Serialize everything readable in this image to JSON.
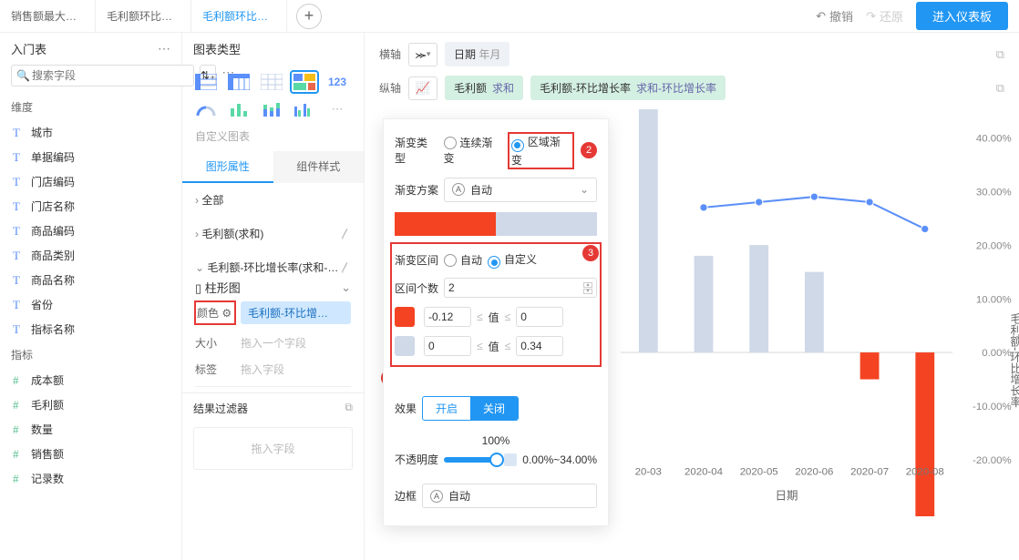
{
  "topbar": {
    "tabs": [
      "销售额最大的…",
      "毛利额环比增…",
      "毛利额环比增…"
    ],
    "active": 2,
    "undo": "撤销",
    "redo": "还原",
    "enter": "进入仪表板"
  },
  "leftA": {
    "title": "入门表",
    "search_ph": "搜索字段",
    "dim_label": "维度",
    "dims": [
      "城市",
      "单据编码",
      "门店编码",
      "门店名称",
      "商品编码",
      "商品类别",
      "商品名称",
      "省份",
      "指标名称"
    ],
    "meas_label": "指标",
    "meas": [
      "成本额",
      "毛利额",
      "数量",
      "销售额",
      "记录数"
    ]
  },
  "leftB": {
    "title": "图表类型",
    "custom": "自定义图表",
    "tab1": "图形属性",
    "tab2": "组件样式",
    "acc_all": "全部",
    "acc_m1": "毛利额(求和)",
    "acc_m2": "毛利额-环比增长率(求和-…",
    "shape": "柱形图",
    "color_lbl": "颜色",
    "color_chip": "毛利额-环比增…",
    "size_lbl": "大小",
    "size_ph": "拖入一个字段",
    "label_lbl": "标签",
    "label_ph": "拖入字段",
    "filter_title": "结果过滤器",
    "filter_ph": "拖入字段"
  },
  "axis": {
    "h_lbl": "横轴",
    "h_field": "日期",
    "h_sub": "年月",
    "v_lbl": "纵轴",
    "v_pill1a": "毛利额",
    "v_pill1b": "求和",
    "v_pill2a": "毛利额-环比增长率",
    "v_pill2b": "求和-环比增长率"
  },
  "panel": {
    "grad_type": "渐变类型",
    "g_cont": "连续渐变",
    "g_area": "区域渐变",
    "grad_scheme": "渐变方案",
    "auto": "自动",
    "interval_lbl": "渐变区间",
    "iv_auto": "自动",
    "iv_custom": "自定义",
    "count_lbl": "区间个数",
    "count_val": "2",
    "mid_word": "值",
    "row1_a": "-0.12",
    "row1_b": "0",
    "row2_a": "0",
    "row2_b": "0.34",
    "effect_lbl": "效果",
    "on": "开启",
    "off": "关闭",
    "opacity_val": "100%",
    "opacity_lbl": "不透明度",
    "legend_txt": "0.00%~34.00%",
    "border_lbl": "边框"
  },
  "chart_data": {
    "type": "bar+line",
    "title": "",
    "xlabel": "日期",
    "ylabel_right": "毛利额-环比增长率",
    "categories": [
      "20-03",
      "2020-04",
      "2020-05",
      "2020-06",
      "2020-07",
      "2020-08"
    ],
    "bars_pct": [
      90,
      18,
      20,
      15,
      -5,
      -35
    ],
    "line_pct": [
      null,
      27,
      28,
      29,
      28,
      23
    ],
    "right_axis_ticks": [
      "40.00%",
      "30.00%",
      "20.00%",
      "10.00%",
      "0.00%",
      "-10.00%",
      "-20.00%"
    ],
    "right_axis_range": [
      -20,
      40
    ]
  },
  "badges": {
    "1": "1",
    "2": "2",
    "3": "3"
  }
}
